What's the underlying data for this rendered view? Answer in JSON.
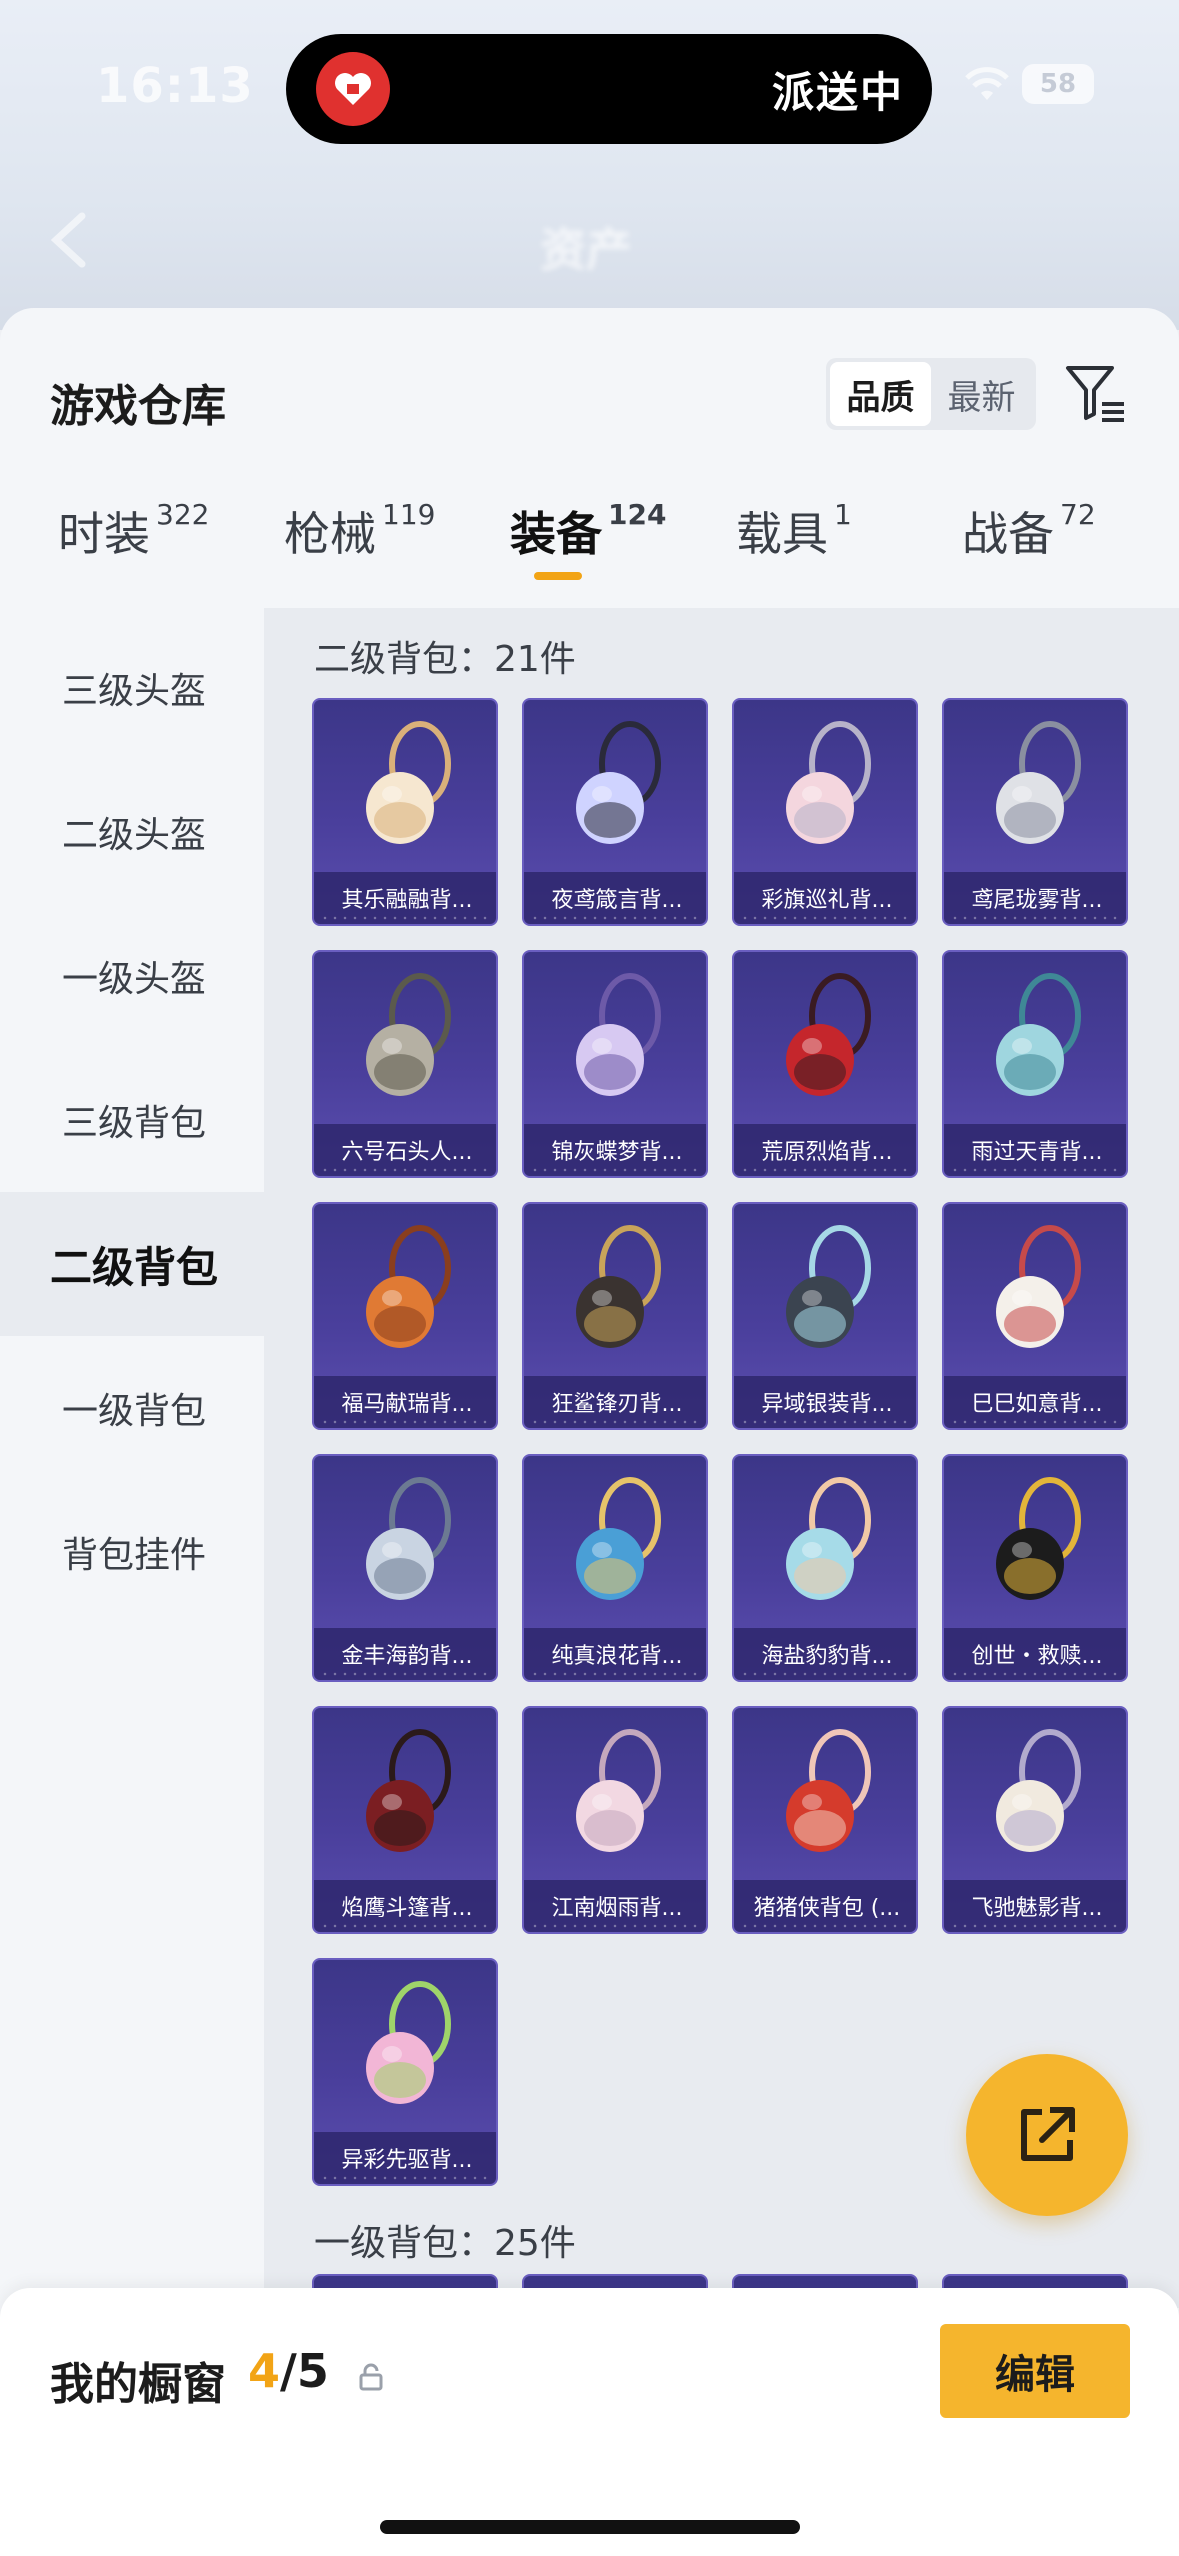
{
  "status": {
    "time": "16:13",
    "battery": "58"
  },
  "island": {
    "text": "派送中"
  },
  "header": {
    "title": "资产"
  },
  "sheet": {
    "title": "游戏仓库",
    "sort": {
      "options": [
        "品质",
        "最新"
      ],
      "active": "品质"
    }
  },
  "tabs": [
    {
      "label": "时装",
      "count": "322"
    },
    {
      "label": "枪械",
      "count": "119"
    },
    {
      "label": "装备",
      "count": "124",
      "active": true
    },
    {
      "label": "载具",
      "count": "1"
    },
    {
      "label": "战备",
      "count": "72"
    }
  ],
  "sidebar": {
    "items": [
      "三级头盔",
      "二级头盔",
      "一级头盔",
      "三级背包",
      "二级背包",
      "一级背包",
      "背包挂件"
    ],
    "active": "二级背包"
  },
  "groups": [
    {
      "title": "二级背包：21件",
      "items": [
        "其乐融融背...",
        "夜鸢箴言背...",
        "彩旗巡礼背...",
        "鸢尾珑雾背...",
        "六号石头人...",
        "锦灰蝶梦背...",
        "荒原烈焰背...",
        "雨过天青背...",
        "福马献瑞背...",
        "狂鲨锋刃背...",
        "异域银装背...",
        "巳巳如意背...",
        "金丰海韵背...",
        "纯真浪花背...",
        "海盐豹豹背...",
        "创世・救赎...",
        "焰鹰斗篷背...",
        "江南烟雨背...",
        "猪猪侠背包 (...",
        "飞驰魅影背...",
        "异彩先驱背..."
      ]
    },
    {
      "title": "一级背包：25件",
      "items": []
    }
  ],
  "bottom": {
    "label": "我的橱窗",
    "current": "4",
    "total": "/5",
    "edit": "编辑"
  },
  "colors": {
    "accent": "#f2a416",
    "card": "#4a3f9c"
  }
}
